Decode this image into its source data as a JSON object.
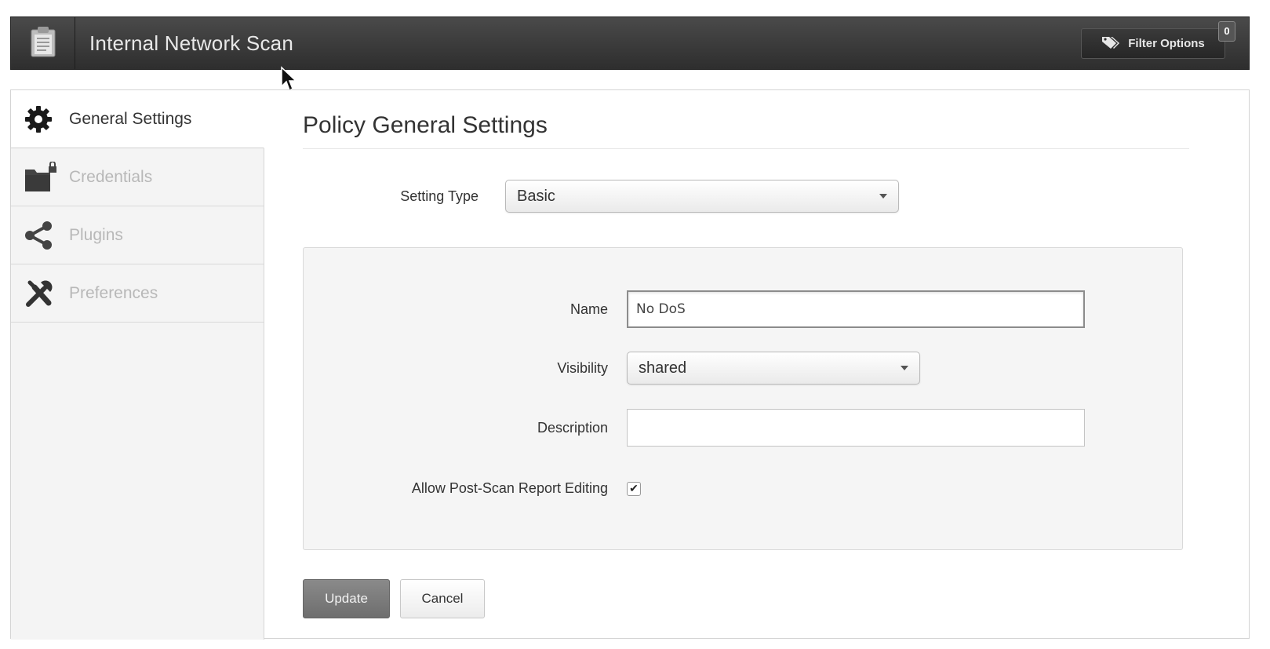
{
  "header": {
    "title": "Internal Network Scan",
    "logo_icon": "clipboard-icon",
    "filter_button": {
      "label": "Filter Options",
      "icon": "tag-icon",
      "badge": "0"
    }
  },
  "sidebar": {
    "items": [
      {
        "label": "General Settings",
        "icon": "gear-icon",
        "active": true
      },
      {
        "label": "Credentials",
        "icon": "folder-lock-icon",
        "active": false
      },
      {
        "label": "Plugins",
        "icon": "share-nodes-icon",
        "active": false
      },
      {
        "label": "Preferences",
        "icon": "tools-icon",
        "active": false
      }
    ]
  },
  "main": {
    "title": "Policy General Settings",
    "setting_type": {
      "label": "Setting Type",
      "value": "Basic"
    },
    "form": {
      "name": {
        "label": "Name",
        "value": "No DoS"
      },
      "visibility": {
        "label": "Visibility",
        "value": "shared"
      },
      "description": {
        "label": "Description",
        "value": ""
      },
      "allow_editing": {
        "label": "Allow Post-Scan Report Editing",
        "checked": true
      }
    },
    "buttons": {
      "update": "Update",
      "cancel": "Cancel"
    }
  },
  "colors": {
    "header_bg": "#333333",
    "sidebar_bg": "#f4f4f4",
    "primary_button": "#7a7a7a"
  }
}
